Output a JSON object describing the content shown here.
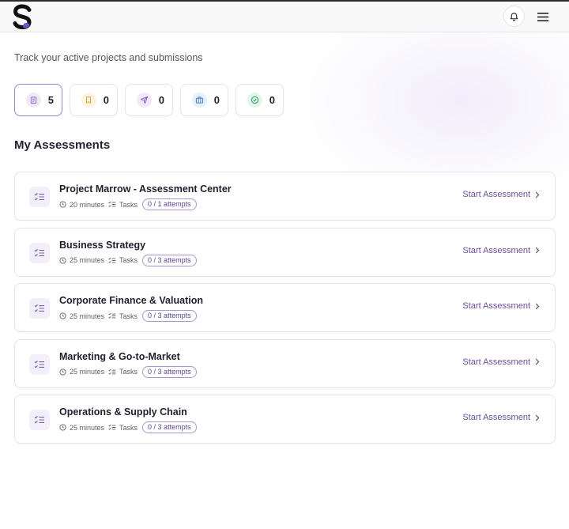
{
  "header": {
    "logo_label": "S",
    "bell": "bell-icon",
    "menu": "hamburger-icon"
  },
  "subtitle": "Track your active projects and submissions",
  "stats": [
    {
      "icon": "clipboard-icon",
      "value": "5",
      "color": "#8b6cc6",
      "bg": "#efe9fa"
    },
    {
      "icon": "bookmark-icon",
      "value": "0",
      "color": "#e0a23a",
      "bg": "#fdf3e2"
    },
    {
      "icon": "send-icon",
      "value": "0",
      "color": "#8b5cc7",
      "bg": "#f1e9fb"
    },
    {
      "icon": "briefcase-icon",
      "value": "0",
      "color": "#4a7fc1",
      "bg": "#e6f0fb"
    },
    {
      "icon": "check-circle-icon",
      "value": "0",
      "color": "#2e9e62",
      "bg": "#e4f5ec"
    }
  ],
  "section_title": "My Assessments",
  "assessments": [
    {
      "title": "Project Marrow - Assessment Center",
      "duration": "20 minutes",
      "tasks": "Tasks",
      "attempts": "0 / 1 attempts",
      "action": "Start Assessment"
    },
    {
      "title": "Business Strategy",
      "duration": "25 minutes",
      "tasks": "Tasks",
      "attempts": "0 / 3 attempts",
      "action": "Start Assessment"
    },
    {
      "title": "Corporate Finance & Valuation",
      "duration": "25 minutes",
      "tasks": "Tasks",
      "attempts": "0 / 3 attempts",
      "action": "Start Assessment"
    },
    {
      "title": "Marketing & Go-to-Market",
      "duration": "25 minutes",
      "tasks": "Tasks",
      "attempts": "0 / 3 attempts",
      "action": "Start Assessment"
    },
    {
      "title": "Operations & Supply Chain",
      "duration": "25 minutes",
      "tasks": "Tasks",
      "attempts": "0 / 3 attempts",
      "action": "Start Assessment"
    }
  ],
  "colors": {
    "accent": "#6a4e9a",
    "pill_border": "#a996cf",
    "active_border": "#9d86c4"
  }
}
